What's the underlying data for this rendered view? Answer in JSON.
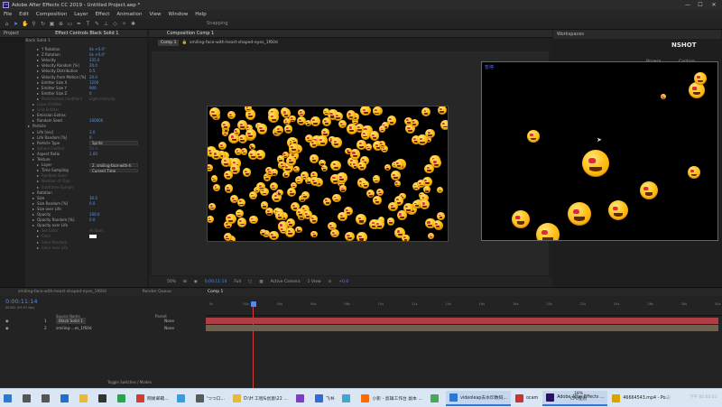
{
  "window": {
    "title": "Adobe After Effects CC 2019 - Untitled Project.aep *",
    "min": "—",
    "max": "☐",
    "close": "✕"
  },
  "menu": [
    "File",
    "Edit",
    "Composition",
    "Layer",
    "Effect",
    "Animation",
    "View",
    "Window",
    "Help"
  ],
  "workspace": {
    "snapping": "Snapping"
  },
  "effect_controls": {
    "tab_project": "Project",
    "tab_effect": "Effect Controls Black Solid 1",
    "breadcrumb": "Comp 1 • Black Solid 1",
    "rows": [
      {
        "label": "Y Rotation",
        "value": "0x +0.0°",
        "indent": 2
      },
      {
        "label": "Z Rotation",
        "value": "0x +0.0°",
        "indent": 2
      },
      {
        "label": "Velocity",
        "value": "235.0",
        "indent": 2
      },
      {
        "label": "Velocity Random [%]",
        "value": "20.0",
        "indent": 2
      },
      {
        "label": "Velocity Distribution",
        "value": "0.5",
        "indent": 2
      },
      {
        "label": "Velocity from Motion [%]",
        "value": "20.0",
        "indent": 2
      },
      {
        "label": "Emitter Size X",
        "value": "1200",
        "indent": 2
      },
      {
        "label": "Emitter Size Y",
        "value": "900",
        "indent": 2
      },
      {
        "label": "Emitter Size Z",
        "value": "0",
        "indent": 2
      },
      {
        "label": "Particles/sec modifiers",
        "value": "Light Intensity",
        "indent": 2,
        "dim": true
      },
      {
        "label": "Layer Emitter",
        "value": "",
        "indent": 1,
        "dim": true
      },
      {
        "label": "Grid Emitter",
        "value": "",
        "indent": 1,
        "dim": true
      },
      {
        "label": "Emission Extras",
        "value": "",
        "indent": 1
      },
      {
        "label": "Random Seed",
        "value": "100000",
        "indent": 1
      },
      {
        "label": "Particle",
        "value": "",
        "indent": 0
      },
      {
        "label": "Life [sec]",
        "value": "3.0",
        "indent": 1
      },
      {
        "label": "Life Random [%]",
        "value": "0",
        "indent": 1
      },
      {
        "label": "Particle Type",
        "value": "Sprite",
        "indent": 1,
        "select": true
      },
      {
        "label": "Sphere Feather",
        "value": "50.0",
        "indent": 1,
        "dim": true
      },
      {
        "label": "Aspect Ratio",
        "value": "1.00",
        "indent": 1
      },
      {
        "label": "Texture",
        "value": "",
        "indent": 1
      },
      {
        "label": "Layer",
        "value": "2. smiling-face-with-h",
        "indent": 2,
        "select": true
      },
      {
        "label": "Time Sampling",
        "value": "Current Time",
        "indent": 2,
        "select": true
      },
      {
        "label": "Random Seed",
        "value": "",
        "indent": 2,
        "dim": true
      },
      {
        "label": "Number of Clips",
        "value": "",
        "indent": 2,
        "dim": true
      },
      {
        "label": "Subframe Sample",
        "value": "",
        "indent": 2,
        "dim": true
      },
      {
        "label": "Rotation",
        "value": "",
        "indent": 1
      },
      {
        "label": "Size",
        "value": "30.0",
        "indent": 1
      },
      {
        "label": "Size Random [%]",
        "value": "0.0",
        "indent": 1
      },
      {
        "label": "Size over Life",
        "value": "",
        "indent": 1
      },
      {
        "label": "Opacity",
        "value": "100.0",
        "indent": 1
      },
      {
        "label": "Opacity Random [%]",
        "value": "0.0",
        "indent": 1
      },
      {
        "label": "Opacity over Life",
        "value": "",
        "indent": 1
      },
      {
        "label": "Set Color",
        "value": "At Start",
        "indent": 2,
        "dim": true
      },
      {
        "label": "Color",
        "value": "",
        "indent": 2,
        "dim": true,
        "swatch": true
      },
      {
        "label": "Color Random",
        "value": "",
        "indent": 2,
        "dim": true
      },
      {
        "label": "Color over Life",
        "value": "",
        "indent": 2,
        "dim": true
      }
    ]
  },
  "composition": {
    "tab": "Composition Comp 1",
    "comp_tab": "Comp 1",
    "layer_label": "smiling-face-with-heart-shaped-eyes_1f60d",
    "footer": {
      "zoom": "50%",
      "timecode": "0;00;11;14",
      "resolution": "Full",
      "camera": "Active Camera",
      "views": "1 View",
      "exposure": "+0.0"
    }
  },
  "right_panel": {
    "header": "Workspaces",
    "snippet_text": "NSHOT",
    "label_browse": "Browse",
    "label_capture": "Capture"
  },
  "popup": {
    "label": "暂停"
  },
  "timeline": {
    "tabs": [
      "smiling-face-with-heart-shaped-eyes_1f60d",
      "Render Queue",
      "Comp 1"
    ],
    "timecode": "0:00:11:14",
    "fps": "00342 (29.97 fps)",
    "col_source": "Source Name",
    "col_parent": "Parent",
    "ticks": [
      "0s",
      "02s",
      "04s",
      "06s",
      "08s",
      "10s",
      "12s",
      "14s",
      "16s",
      "18s",
      "20s",
      "22s",
      "24s",
      "26s",
      "28s",
      "30s"
    ],
    "layers": [
      {
        "num": "1",
        "name": "Black Solid 1",
        "parent": "None"
      },
      {
        "num": "2",
        "name": "smiling-...es_1f60d",
        "parent": "None"
      }
    ],
    "toggle_label": "Toggle Switches / Modes"
  },
  "taskbar": {
    "items": [
      {
        "label": "",
        "icon": "windows-icon",
        "color": "#2d79d0"
      },
      {
        "label": "",
        "icon": "search-icon",
        "color": "#555555"
      },
      {
        "label": "",
        "icon": "task-view-icon",
        "color": "#555555"
      },
      {
        "label": "",
        "icon": "ie-icon",
        "color": "#1f6fcc"
      },
      {
        "label": "",
        "icon": "folder-icon",
        "color": "#e8b83c"
      },
      {
        "label": "",
        "icon": "store-icon",
        "color": "#333333"
      },
      {
        "label": "",
        "icon": "chat-icon",
        "color": "#2aa34a"
      },
      {
        "label": "网易邮箱...",
        "icon": "mail-icon",
        "color": "#d33b2c"
      },
      {
        "label": "",
        "icon": "qq-icon",
        "color": "#3a9be0"
      },
      {
        "label": "'つつ口...",
        "icon": "doc-icon",
        "color": "#5a5a5a"
      },
      {
        "label": "D:\\H 工程&创意\\22 ...",
        "icon": "folder-icon",
        "color": "#e8b83c"
      },
      {
        "label": "",
        "icon": "app-icon",
        "color": "#7a3fc4"
      },
      {
        "label": "飞书",
        "icon": "feishu-icon",
        "color": "#2f6bdc"
      },
      {
        "label": "",
        "icon": "app-icon",
        "color": "#3fa7d6"
      },
      {
        "label": "小影 - 剪辑工作台 副本 ...",
        "icon": "app-icon",
        "color": "#ff6a00"
      },
      {
        "label": "",
        "icon": "app-icon",
        "color": "#44aa55"
      },
      {
        "label": "videoleap去水印数码...",
        "icon": "browser-icon",
        "color": "#2d79d0",
        "active": true
      },
      {
        "label": "ocam",
        "icon": "ocam-icon",
        "color": "#cc3333"
      },
      {
        "label": "Adobe After Effects ...",
        "icon": "ae-icon",
        "color": "#2a0e62",
        "active": true
      },
      {
        "label": "46664543.mp4 - Po...",
        "icon": "player-icon",
        "color": "#d9a400"
      }
    ],
    "cpu_line1": "18%",
    "cpu_line2": "CPU使用",
    "ime": "中",
    "time": "下午 05:02:41"
  }
}
